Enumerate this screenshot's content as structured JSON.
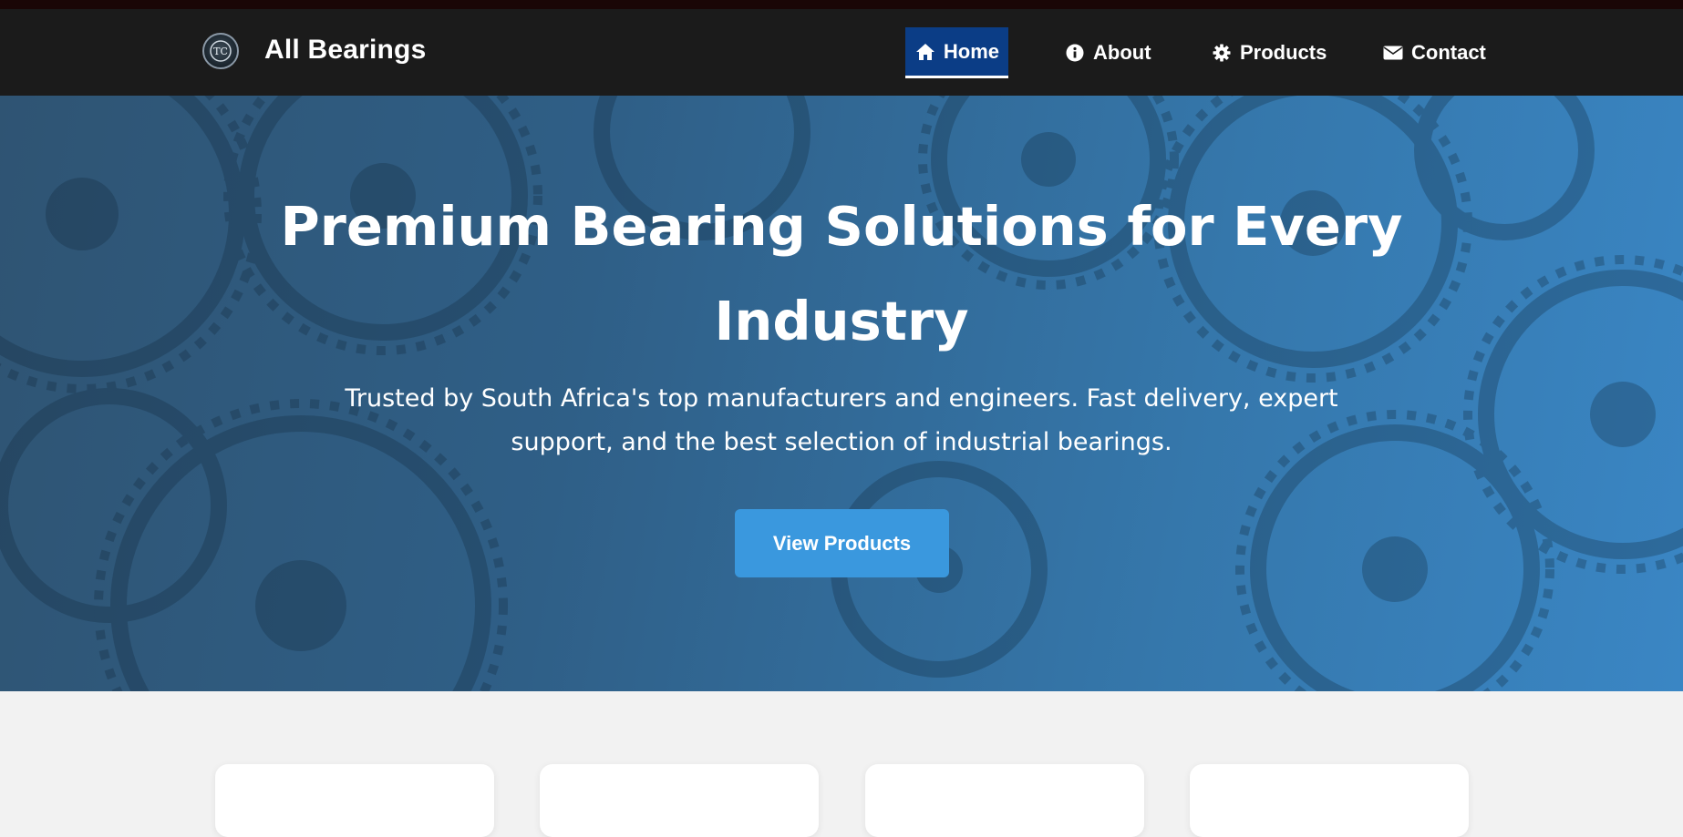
{
  "brand": {
    "name": "All Bearings",
    "logo_text": "TC"
  },
  "nav": {
    "items": [
      {
        "label": "Home",
        "icon": "home-icon",
        "active": true
      },
      {
        "label": "About",
        "icon": "info-icon",
        "active": false
      },
      {
        "label": "Products",
        "icon": "gear-icon",
        "active": false
      },
      {
        "label": "Contact",
        "icon": "envelope-icon",
        "active": false
      }
    ]
  },
  "hero": {
    "title": "Premium Bearing Solutions for Every Industry",
    "subtitle": "Trusted by South Africa's top manufacturers and engineers. Fast delivery, expert support, and the best selection of industrial bearings.",
    "cta_label": "View Products"
  },
  "colors": {
    "nav_bg": "#1b1b1b",
    "nav_active_bg": "#0b3d86",
    "hero_start": "#2f5473",
    "hero_end": "#3a86c4",
    "cta_bg": "#3a98de",
    "page_bg": "#f2f2f2"
  }
}
